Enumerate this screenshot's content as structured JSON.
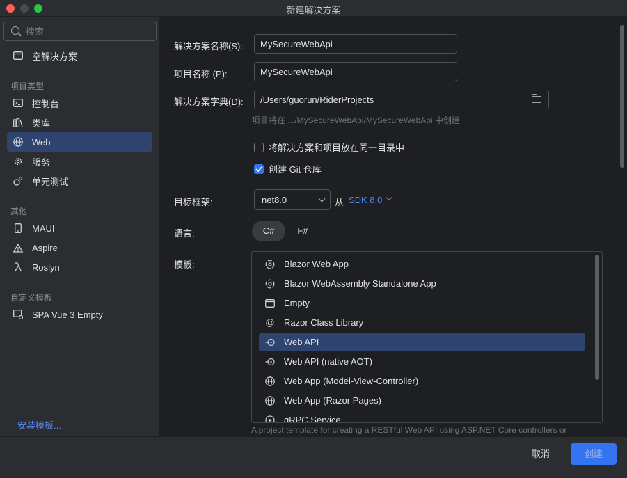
{
  "window": {
    "title": "新建解决方案"
  },
  "sidebar": {
    "search_placeholder": "搜索",
    "top_items": [
      {
        "label": "空解决方案",
        "icon": "window-icon"
      }
    ],
    "sections": [
      {
        "header": "项目类型",
        "items": [
          {
            "label": "控制台",
            "icon": "console-icon"
          },
          {
            "label": "类库",
            "icon": "library-icon"
          },
          {
            "label": "Web",
            "icon": "globe-icon",
            "selected": true
          },
          {
            "label": "服务",
            "icon": "gear-icon"
          },
          {
            "label": "单元测试",
            "icon": "test-icon"
          }
        ]
      },
      {
        "header": "其他",
        "items": [
          {
            "label": "MAUI",
            "icon": "phone-icon"
          },
          {
            "label": "Aspire",
            "icon": "aspire-icon"
          },
          {
            "label": "Roslyn",
            "icon": "lambda-icon"
          }
        ]
      },
      {
        "header": "自定义模板",
        "items": [
          {
            "label": "SPA Vue 3 Empty",
            "icon": "template-icon"
          }
        ]
      }
    ],
    "install_link": "安装模板..."
  },
  "form": {
    "solution_name": {
      "label": "解决方案名称(S):",
      "value": "MySecureWebApi"
    },
    "project_name": {
      "label": "项目名称 (P):",
      "value": "MySecureWebApi"
    },
    "solution_dir": {
      "label": "解决方案字典(D):",
      "value": "/Users/guorun/RiderProjects"
    },
    "hint": "项目将在 .../MySecureWebApi/MySecureWebApi 中创建",
    "same_dir": {
      "label": "将解决方案和项目放在同一目录中",
      "checked": false
    },
    "git": {
      "label": "创建 Git 仓库",
      "checked": true
    },
    "framework": {
      "label": "目标框架:",
      "value": "net8.0",
      "from": "从",
      "sdk": "SDK 8.0"
    },
    "language": {
      "label": "语言:",
      "options": [
        "C#",
        "F#"
      ],
      "selected": "C#"
    },
    "templates": {
      "label": "模板:",
      "items": [
        {
          "label": "Blazor Web App",
          "icon": "blazor-icon"
        },
        {
          "label": "Blazor WebAssembly Standalone App",
          "icon": "blazor-icon"
        },
        {
          "label": "Empty",
          "icon": "window-icon"
        },
        {
          "label": "Razor Class Library",
          "icon": "at-icon"
        },
        {
          "label": "Web API",
          "icon": "api-icon",
          "selected": true
        },
        {
          "label": "Web API (native AOT)",
          "icon": "api-icon"
        },
        {
          "label": "Web App (Model-View-Controller)",
          "icon": "globe-icon"
        },
        {
          "label": "Web App (Razor Pages)",
          "icon": "globe-icon"
        },
        {
          "label": "gRPC Service",
          "icon": "grpc-icon"
        }
      ],
      "description": "A project template for creating a RESTful Web API using ASP.NET Core controllers or"
    }
  },
  "footer": {
    "cancel": "取消",
    "create": "创建"
  },
  "colors": {
    "accent": "#3574f0",
    "selection": "#2e436e",
    "link": "#548af7"
  }
}
